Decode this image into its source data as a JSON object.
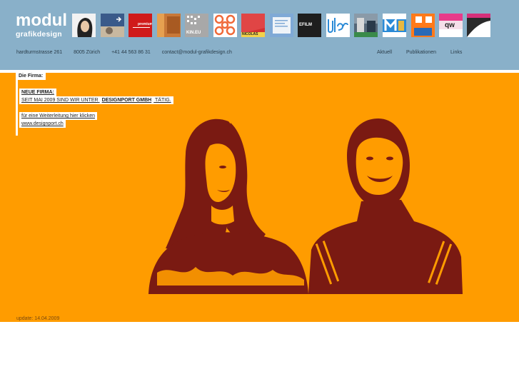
{
  "brand": {
    "line1": "modul",
    "line2": "grafikdesign"
  },
  "thumbnails": [
    {
      "name": "thumb-portrait-woman",
      "bg": "#f2f2f2"
    },
    {
      "name": "thumb-arrow-photo",
      "bg": "#3a5a8a"
    },
    {
      "name": "thumb-premium",
      "bg": "#d01a1a",
      "caption": "premium"
    },
    {
      "name": "thumb-wood",
      "bg": "#c87838"
    },
    {
      "name": "thumb-kin",
      "bg": "#a8a8a8",
      "caption": "KIN.EU"
    },
    {
      "name": "thumb-pattern",
      "bg": "#f06a3a"
    },
    {
      "name": "thumb-nicolas",
      "bg": "#d33030",
      "caption": "NICOLAS"
    },
    {
      "name": "thumb-document",
      "bg": "#7fa9d6"
    },
    {
      "name": "thumb-film",
      "bg": "#1e1e1e",
      "caption": "EFILM"
    },
    {
      "name": "thumb-blc",
      "bg": "#ffffff",
      "caption": "blc"
    },
    {
      "name": "thumb-building",
      "bg": "#556677"
    },
    {
      "name": "thumb-m-logo",
      "bg": "#2a8ad6",
      "caption": "M"
    },
    {
      "name": "thumb-orange-photo",
      "bg": "#ff7a1a"
    },
    {
      "name": "thumb-qw",
      "bg": "#f5e0ea",
      "caption": "qw"
    },
    {
      "name": "thumb-dark-curve",
      "bg": "#2a2a2a"
    }
  ],
  "contact": {
    "street": "hardturmstrasse 261",
    "city": "8005 Zürich",
    "phone": "+41 44 563 86 31",
    "email": "contact@modul-grafikdesign.ch"
  },
  "nav": {
    "aktuell": "Aktuell",
    "publikationen": "Publikationen",
    "links": "Links"
  },
  "content": {
    "firma_label": "Die Firma:",
    "neue_firma": "NEUE  FIRMA:",
    "seit_prefix": "SEIT MAI 2009 SIND WIR UNTER",
    "company": "DESIGNPORT GMBH",
    "seit_suffix": "TÄTIG.",
    "redirect_text": "für eine Weiterleitung hier klicken",
    "url": "www.designport.ch"
  },
  "update": "update: 14.04.2009",
  "colors": {
    "header": "#89b0c9",
    "orange": "#ff9c00",
    "portrait": "#7a1a12"
  }
}
